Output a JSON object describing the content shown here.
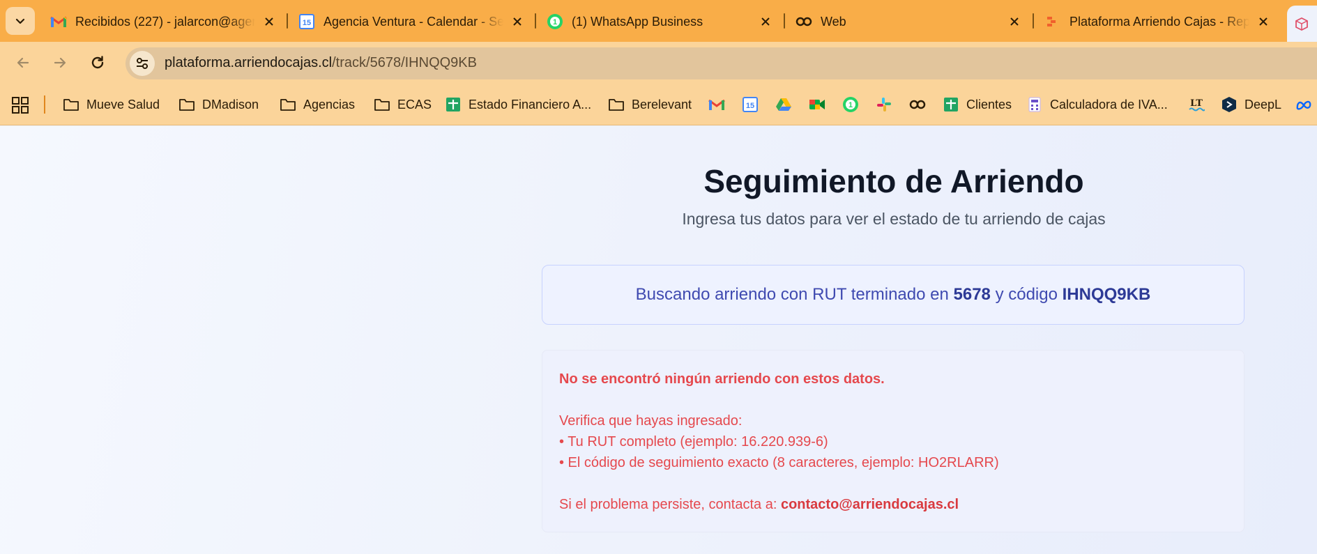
{
  "tabs": [
    {
      "title": "Recibidos (227) - jalarcon@agen",
      "icon": "gmail-icon"
    },
    {
      "title": "Agencia Ventura - Calendar - Se",
      "icon": "calendar-icon"
    },
    {
      "title": "(1) WhatsApp Business",
      "icon": "whatsapp-icon"
    },
    {
      "title": "Web",
      "icon": "web-icon"
    },
    {
      "title": "Plataforma Arriendo Cajas - Rep",
      "icon": "bolt-icon"
    }
  ],
  "address_bar": {
    "host": "plataforma.arriendocajas.cl",
    "path": "/track/5678/IHNQQ9KB"
  },
  "bookmarks": [
    {
      "label": "Mueve Salud",
      "icon": "folder-icon"
    },
    {
      "label": "DMadison",
      "icon": "folder-icon"
    },
    {
      "label": "Agencias",
      "icon": "folder-icon"
    },
    {
      "label": "ECAS",
      "icon": "folder-icon"
    },
    {
      "label": "Estado Financiero A...",
      "icon": "sheets-icon"
    },
    {
      "label": "Berelevant",
      "icon": "folder-icon"
    },
    {
      "label": "Clientes",
      "icon": "sheets-icon"
    },
    {
      "label": "Calculadora de IVA...",
      "icon": "calculator-icon"
    },
    {
      "label": "DeepL",
      "icon": "deepl-icon"
    }
  ],
  "page": {
    "title": "Seguimiento de Arriendo",
    "subtitle": "Ingresa tus datos para ver el estado de tu arriendo de cajas",
    "search_info": {
      "prefix": "Buscando arriendo con RUT terminado en",
      "rut_suffix": "5678",
      "middle": "y código",
      "code": "IHNQQ9KB"
    },
    "error": {
      "title": "No se encontró ningún arriendo con estos datos.",
      "verify_intro": "Verifica que hayas ingresado:",
      "bullet_1": "• Tu RUT completo (ejemplo: 16.220.939-6)",
      "bullet_2": "• El código de seguimiento exacto (8 caracteres, ejemplo: HO2RLARR)",
      "contact_text": "Si el problema persiste, contacta a:",
      "contact_email": "contacto@arriendocajas.cl"
    }
  },
  "colors": {
    "tab_strip": "#f9ad48",
    "toolbar": "#fbd49a",
    "heading": "#111827",
    "info_text": "#3f4ab0",
    "error_text": "#e5484d"
  }
}
